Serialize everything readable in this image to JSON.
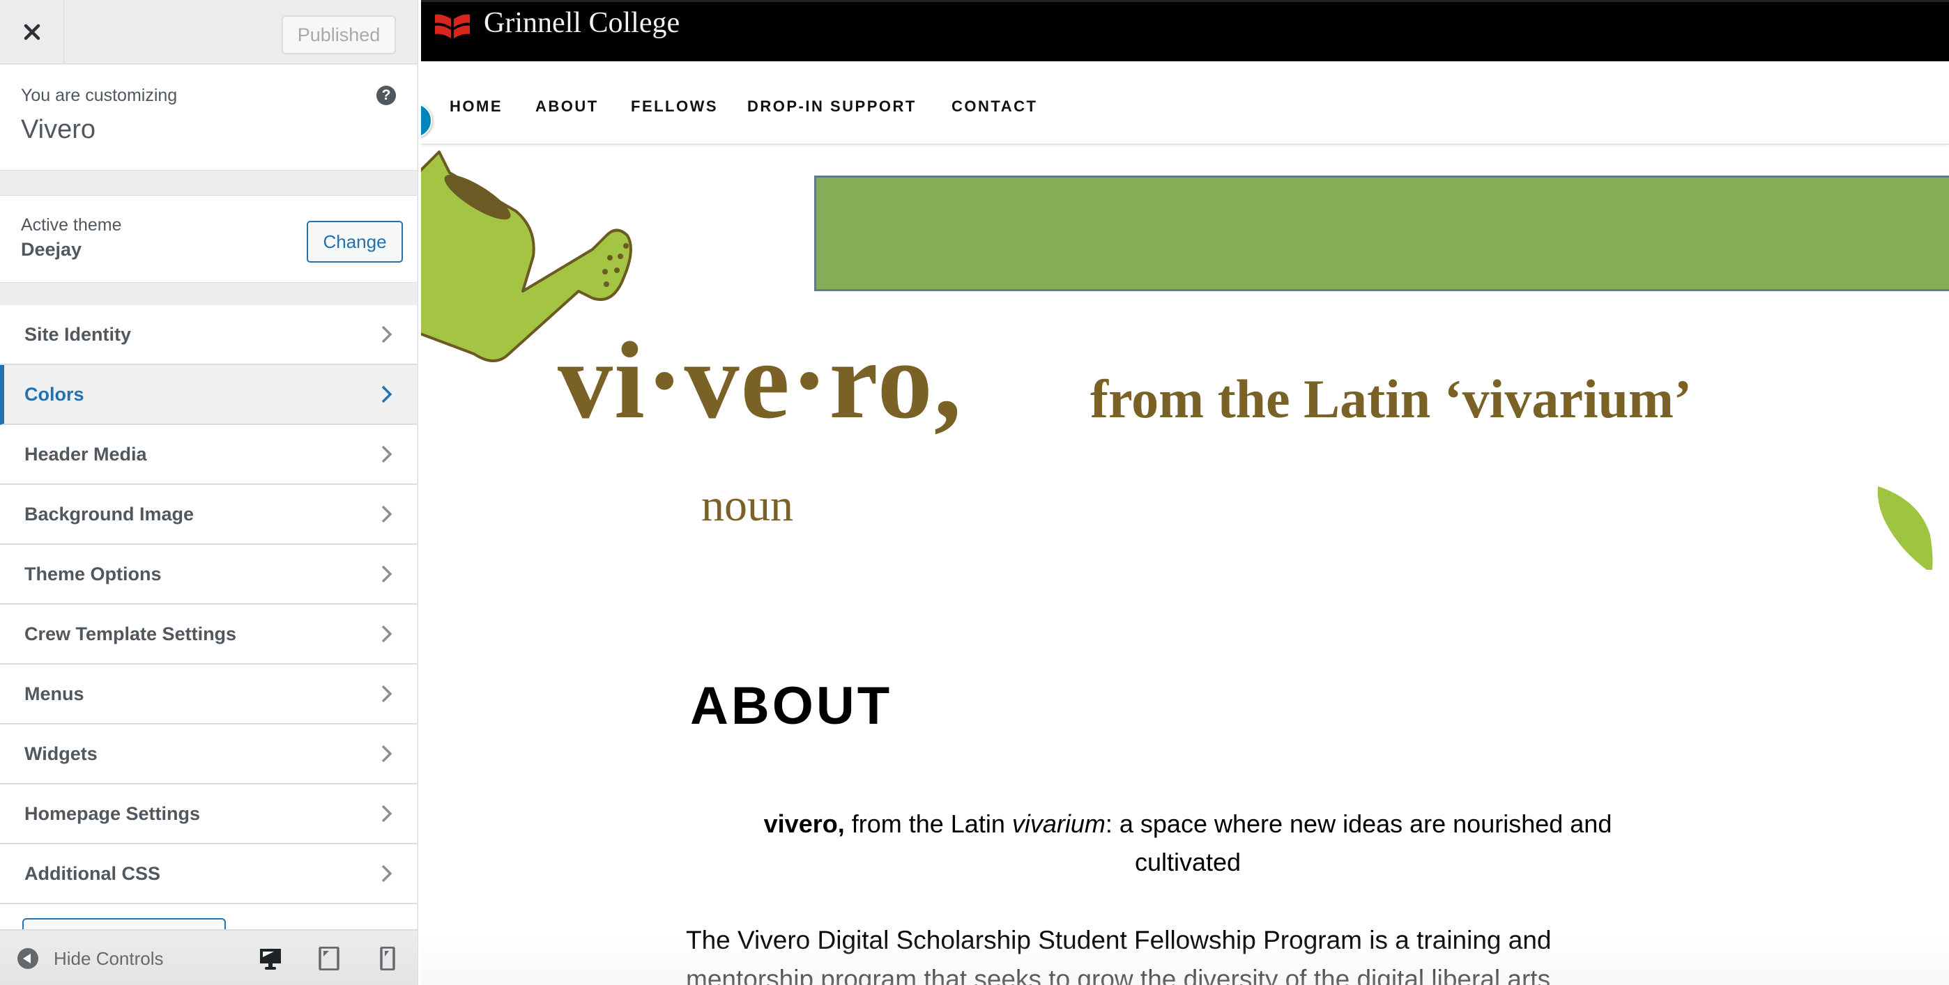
{
  "customizer": {
    "close_label": "Close",
    "publish_button": "Published",
    "info": {
      "label": "You are customizing",
      "site_title": "Vivero",
      "help": "?"
    },
    "theme": {
      "label": "Active theme",
      "name": "Deejay",
      "change_button": "Change"
    },
    "sections": [
      {
        "label": "Site Identity",
        "active": false
      },
      {
        "label": "Colors",
        "active": true
      },
      {
        "label": "Header Media",
        "active": false
      },
      {
        "label": "Background Image",
        "active": false
      },
      {
        "label": "Theme Options",
        "active": false
      },
      {
        "label": "Crew Template Settings",
        "active": false
      },
      {
        "label": "Menus",
        "active": false
      },
      {
        "label": "Widgets",
        "active": false
      },
      {
        "label": "Homepage Settings",
        "active": false
      },
      {
        "label": "Additional CSS",
        "active": false
      }
    ],
    "footer": {
      "hide_controls": "Hide Controls",
      "devices": [
        "desktop",
        "tablet",
        "mobile"
      ],
      "selected_device": "desktop"
    }
  },
  "preview": {
    "brand": {
      "name": "Grinnell College",
      "logo_color": "#d9261c"
    },
    "nav": [
      "HOME",
      "ABOUT",
      "FELLOWS",
      "DROP-IN SUPPORT",
      "CONTACT"
    ],
    "hero": {
      "headword": "vi·ve·ro,",
      "etymology": "from the Latin ‘vivarium’",
      "part_of_speech": "noun",
      "banner_color": "#85ad58",
      "text_color": "#7a6227"
    },
    "page_title": "ABOUT",
    "tagline": {
      "bold": "vivero,",
      "plain1": " from the Latin ",
      "italic": "vivarium",
      "plain2": ": a space where new ideas are nourished and",
      "line2": "cultivated"
    },
    "body_lines": [
      "The Vivero Digital Scholarship Student Fellowship Program is a training and",
      "mentorship program that seeks to grow the diversity of the digital liberal arts"
    ]
  },
  "colors": {
    "accent": "#2271b1",
    "text": "#50575e",
    "shortcut": "#0085ba"
  }
}
